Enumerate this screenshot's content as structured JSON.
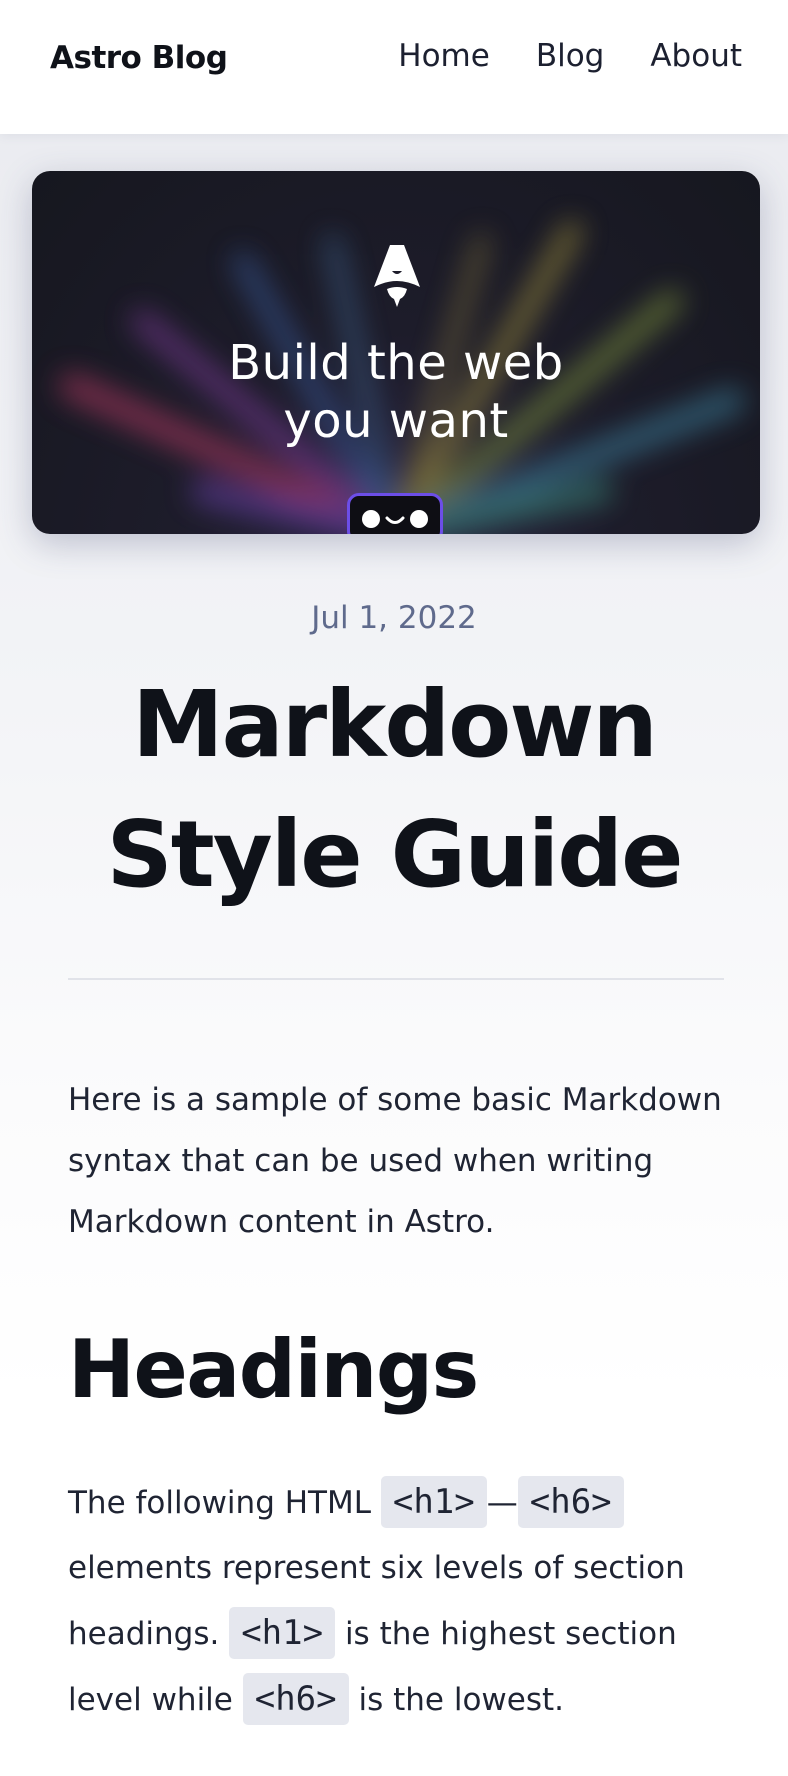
{
  "header": {
    "brand": "Astro Blog",
    "nav": [
      {
        "label": "Home"
      },
      {
        "label": "Blog"
      },
      {
        "label": "About"
      }
    ]
  },
  "hero": {
    "line1": "Build the web",
    "line2": "you want"
  },
  "post": {
    "date": "Jul 1, 2022",
    "title": "Markdown Style Guide",
    "intro": "Here is a sample of some basic Markdown syntax that can be used when writing Markdown content in Astro.",
    "section_heading": "Headings",
    "para": {
      "t1": "The following HTML ",
      "code1": "<h1>",
      "dash": "—",
      "code2": "<h6>",
      "t2": " elements represent six levels of section headings. ",
      "code3": "<h1>",
      "t3": " is the highest section level while ",
      "code4": "<h6>",
      "t4": " is the lowest."
    }
  },
  "colors": {
    "background": "#eef0f3",
    "heading": "#0f1219",
    "date": "#5f6a8c",
    "code_bg": "#e5e7ee",
    "hero_bg": "#1d1c2a",
    "bot_border": "#6c4ee8"
  }
}
